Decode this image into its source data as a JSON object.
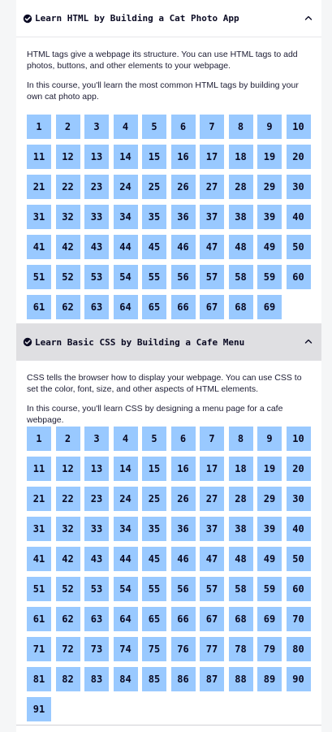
{
  "courses": [
    {
      "title": "Learn HTML by Building a Cat Photo App",
      "description_1": "HTML tags give a webpage its structure. You can use HTML tags to add photos, buttons, and other elements to your webpage.",
      "description_2": "In this course, you'll learn the most common HTML tags by building your own cat photo app.",
      "step_count": 69,
      "steps": [
        "1",
        "2",
        "3",
        "4",
        "5",
        "6",
        "7",
        "8",
        "9",
        "10",
        "11",
        "12",
        "13",
        "14",
        "15",
        "16",
        "17",
        "18",
        "19",
        "20",
        "21",
        "22",
        "23",
        "24",
        "25",
        "26",
        "27",
        "28",
        "29",
        "30",
        "31",
        "32",
        "33",
        "34",
        "35",
        "36",
        "37",
        "38",
        "39",
        "40",
        "41",
        "42",
        "43",
        "44",
        "45",
        "46",
        "47",
        "48",
        "49",
        "50",
        "51",
        "52",
        "53",
        "54",
        "55",
        "56",
        "57",
        "58",
        "59",
        "60",
        "61",
        "62",
        "63",
        "64",
        "65",
        "66",
        "67",
        "68",
        "69"
      ]
    },
    {
      "title": "Learn Basic CSS by Building a Cafe Menu",
      "description_1": "CSS tells the browser how to display your webpage. You can use CSS to set the color, font, size, and other aspects of HTML elements.",
      "description_2": "In this course, you'll learn CSS by designing a menu page for a cafe webpage.",
      "step_count": 91,
      "steps": [
        "1",
        "2",
        "3",
        "4",
        "5",
        "6",
        "7",
        "8",
        "9",
        "10",
        "11",
        "12",
        "13",
        "14",
        "15",
        "16",
        "17",
        "18",
        "19",
        "20",
        "21",
        "22",
        "23",
        "24",
        "25",
        "26",
        "27",
        "28",
        "29",
        "30",
        "31",
        "32",
        "33",
        "34",
        "35",
        "36",
        "37",
        "38",
        "39",
        "40",
        "41",
        "42",
        "43",
        "44",
        "45",
        "46",
        "47",
        "48",
        "49",
        "50",
        "51",
        "52",
        "53",
        "54",
        "55",
        "56",
        "57",
        "58",
        "59",
        "60",
        "61",
        "62",
        "63",
        "64",
        "65",
        "66",
        "67",
        "68",
        "69",
        "70",
        "71",
        "72",
        "73",
        "74",
        "75",
        "76",
        "77",
        "78",
        "79",
        "80",
        "81",
        "82",
        "83",
        "84",
        "85",
        "86",
        "87",
        "88",
        "89",
        "90",
        "91"
      ]
    }
  ],
  "colors": {
    "step_bg": "#99c9ff",
    "active_header_bg": "#dfdfe2",
    "text": "#0a0a23"
  },
  "icons": {
    "completed": "check-circle-icon",
    "collapse": "chevron-up-icon"
  }
}
